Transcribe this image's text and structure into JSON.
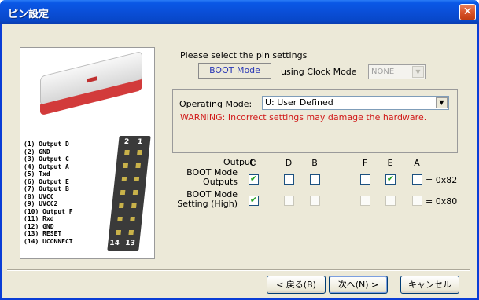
{
  "window": {
    "title": "ピン設定",
    "close_icon": "close-icon"
  },
  "image_panel": {
    "pin_list": [
      "(1) Output D",
      "(2) GND",
      "(3) Output C",
      "(4) Output A",
      "(5) Txd",
      "(6) Output E",
      "(7) Output B",
      "(8) UVCC",
      "(9) UVCC2",
      "(10) Output F",
      "(11) Rxd",
      "(12) GND",
      "(13) RESET",
      "(14) UCONNECT"
    ],
    "connector_labels": {
      "top_left": "2",
      "top_right": "1",
      "bottom_left": "14",
      "bottom_right": "13"
    }
  },
  "prompt": "Please select the pin settings",
  "boot_mode_label": "BOOT Mode",
  "clock_label": "using Clock Mode",
  "clock_select": {
    "value": "NONE",
    "disabled": true
  },
  "operating_mode": {
    "label": "Operating Mode:",
    "value": "U: User Defined"
  },
  "warning": "WARNING: Incorrect settings may damage the hardware.",
  "pin_table": {
    "output_label": "Output:",
    "columns": [
      "C",
      "D",
      "B",
      "F",
      "E",
      "A"
    ],
    "rows": [
      {
        "label_line1": "BOOT Mode",
        "label_line2": "Outputs",
        "checked": [
          true,
          false,
          false,
          false,
          true,
          false
        ],
        "value": "= 0x82",
        "disabled": [
          false,
          false,
          false,
          false,
          false,
          false
        ]
      },
      {
        "label_line1": "BOOT Mode",
        "label_line2": "Setting (High)",
        "checked": [
          true,
          false,
          false,
          false,
          false,
          false
        ],
        "value": "= 0x80",
        "disabled": [
          false,
          true,
          true,
          true,
          true,
          true
        ]
      }
    ]
  },
  "buttons": {
    "back": "< 戻る(B)",
    "next": "次へ(N) >",
    "cancel": "キャンセル"
  }
}
